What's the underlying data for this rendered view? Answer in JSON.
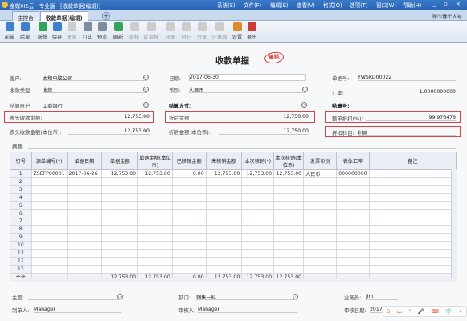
{
  "window": {
    "title": "金蝶KIS云 - 专业版 - [收款单据(编辑)]",
    "menu": [
      "系统(S)",
      "文件(F)",
      "编辑(E)",
      "查看(V)",
      "格式(O)",
      "选项(T)",
      "窗口(W)",
      "帮助(H)"
    ],
    "controls": "_ ▫ ×"
  },
  "tabs": {
    "items": [
      "主控台",
      "收款单据(编辑)"
    ],
    "add": "+"
  },
  "user": "徐少春个人号",
  "toolbar": [
    {
      "label": "前单",
      "icon": "prev-doc-icon",
      "disabled": false
    },
    {
      "label": "后单",
      "icon": "next-doc-icon",
      "disabled": false
    },
    {
      "label": "新增",
      "icon": "new-doc-icon",
      "disabled": false
    },
    {
      "label": "保存",
      "icon": "save-icon",
      "disabled": false
    },
    {
      "label": "复原",
      "icon": "restore-icon",
      "disabled": true
    },
    {
      "label": "打印",
      "icon": "print-icon",
      "disabled": false
    },
    {
      "label": "预览",
      "icon": "preview-icon",
      "disabled": false
    },
    {
      "label": "刷新",
      "icon": "refresh-icon",
      "disabled": false
    },
    {
      "label": "审核",
      "icon": "audit-icon",
      "disabled": true
    },
    {
      "label": "反审核",
      "icon": "unaudit-icon",
      "disabled": true
    },
    {
      "label": "还原",
      "icon": "revert-icon",
      "disabled": true
    },
    {
      "label": "合计",
      "icon": "sum-icon",
      "disabled": true
    },
    {
      "label": "分录",
      "icon": "entry-icon",
      "disabled": true
    },
    {
      "label": "计算器",
      "icon": "calculator-icon",
      "disabled": true
    },
    {
      "label": "设置",
      "icon": "settings-icon",
      "disabled": false
    },
    {
      "label": "退出",
      "icon": "exit-icon",
      "disabled": false
    }
  ],
  "header": {
    "doc_title": "收款单据",
    "stamp": "审核",
    "customer": {
      "label": "客户:",
      "value": "太和电脑公司"
    },
    "receipt_type": {
      "label": "收款类型:",
      "value": "收款"
    },
    "settle_account": {
      "label": "结算账户:",
      "value": "工商银行"
    },
    "header_receipt_amount": {
      "label": "表头收款金额:",
      "value": "12,753.00"
    },
    "header_receipt_amount_base": {
      "label": "表头收款金额(本位币):",
      "value": "12,753.00"
    },
    "date": {
      "label": "日期:",
      "value": "2017-06-30"
    },
    "currency": {
      "label": "币别:",
      "value": "人民币"
    },
    "settle_method": {
      "label": "结算方式:",
      "value": ""
    },
    "discounted_amount": {
      "label": "折后金额:",
      "value": "12,750.00"
    },
    "discounted_amount_base": {
      "label": "折后金额(本位币):",
      "value": "12,750.00"
    },
    "doc_no": {
      "label": "单据号:",
      "value": "YWSKD00022"
    },
    "exchange_rate": {
      "label": "汇率:",
      "value": "1.0000000000"
    },
    "settle_no": {
      "label": "结算号:",
      "value": ""
    },
    "overall_discount": {
      "label": "整单折扣(%):",
      "value": "99.976476"
    },
    "discount_subject": {
      "label": "折扣科目:",
      "value": "利息"
    },
    "summary": {
      "label": "摘要:",
      "value": ""
    }
  },
  "grid": {
    "columns": [
      "行号",
      "源单编号(*)",
      "单据日期",
      "单据金额",
      "单据金额(本位币)",
      "已核销金额",
      "未核销金额",
      "本次核销(*)",
      "本次核销(本位币)",
      "发票币别",
      "表体汇率",
      "备注"
    ],
    "rows": [
      [
        "1",
        "ZSEFP00001",
        "2017-06-26",
        "12,753.00",
        "12,753.00",
        "0.00",
        "12,753.00",
        "12,753.00",
        "12,753.00",
        "人民币",
        "000000000",
        ""
      ]
    ],
    "row_numbers": [
      "1",
      "2",
      "3",
      "4",
      "5",
      "6",
      "7",
      "8",
      "9",
      "10",
      "11",
      "12",
      "13"
    ],
    "total": {
      "label": "合计",
      "values": [
        "12,753.00",
        "12,753.00",
        "0.00",
        "12,753.00",
        "12,753.00",
        "12,753.00"
      ]
    }
  },
  "footer": {
    "supervisor": {
      "label": "主管:",
      "value": ""
    },
    "department": {
      "label": "部门:",
      "value": "销售一科"
    },
    "salesman": {
      "label": "业务员:",
      "value": "Jim"
    },
    "maker": {
      "label": "制单人:",
      "value": "Manager"
    },
    "auditor": {
      "label": "审核人:",
      "value": "Manager"
    },
    "audit_date": {
      "label": "审核日期:",
      "value": "2017"
    }
  },
  "taskbar": {
    "items": [
      "S",
      "中",
      "°",
      "🎤",
      "⌨",
      "👕",
      "✦"
    ]
  }
}
